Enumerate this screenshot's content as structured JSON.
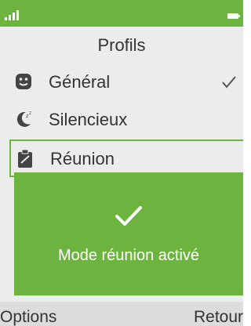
{
  "status_bar": {
    "signal_icon": "signal-icon",
    "battery_icon": "battery-icon",
    "accent_color": "#6db33f"
  },
  "header": {
    "title": "Profils"
  },
  "profiles": [
    {
      "label": "Général",
      "icon": "smiley-icon",
      "active": true
    },
    {
      "label": "Silencieux",
      "icon": "moon-icon",
      "active": false
    },
    {
      "label": "Réunion",
      "icon": "clipboard-icon",
      "active": false,
      "focused": true
    }
  ],
  "dialog": {
    "icon": "check-icon",
    "message": "Mode réunion activé"
  },
  "softkeys": {
    "left": "Options",
    "right": "Retour"
  }
}
